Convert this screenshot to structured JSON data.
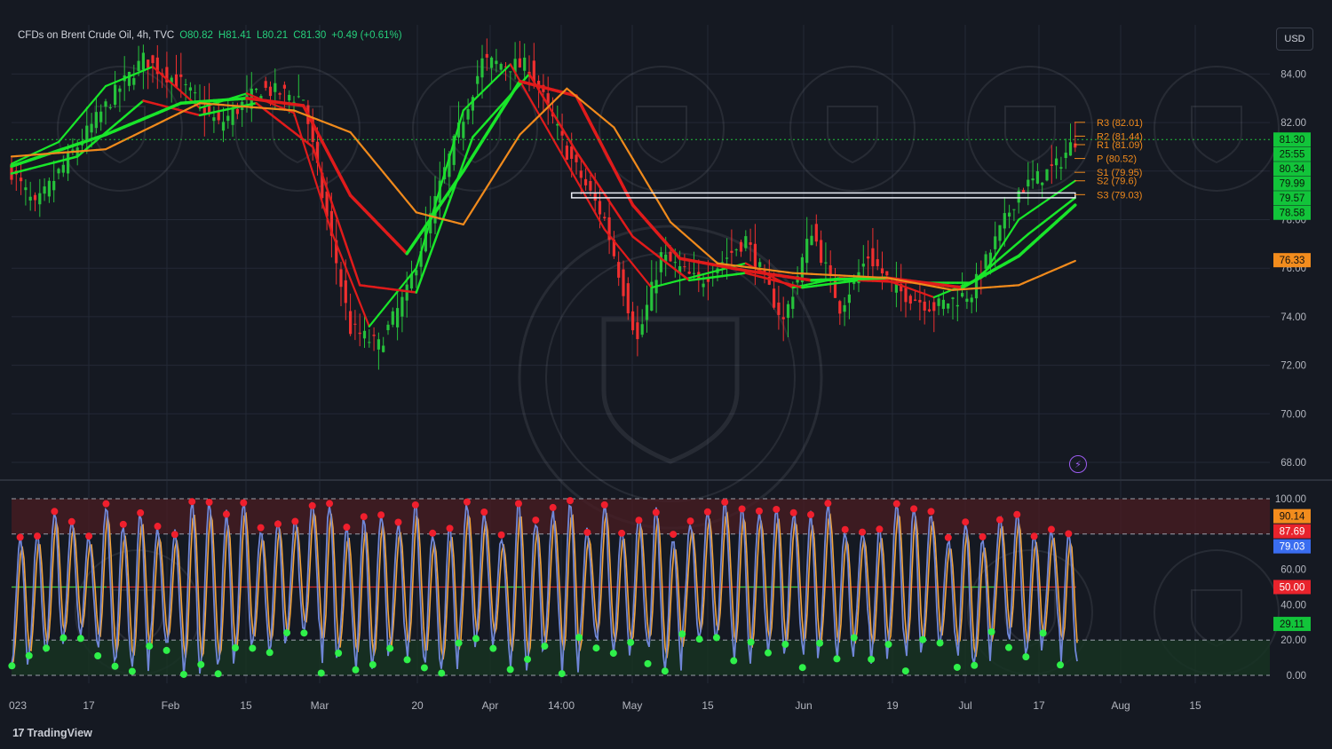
{
  "header": {
    "symbol": "CFDs on Brent Crude Oil, 4h, TVC",
    "open": "O80.82",
    "high": "H81.41",
    "low": "L80.21",
    "close": "C81.30",
    "change": "+0.49 (+0.61%)",
    "currency_label": "USD"
  },
  "brand": {
    "name": "TradingView",
    "logo_text": "17"
  },
  "colors": {
    "background": "#151922",
    "bull": "#26c13b",
    "bear": "#ef2f2f",
    "ma_green": "#19e62a",
    "ma_red": "#e01b1b",
    "ma_orange": "#f08a1c",
    "stoch_k": "#6f86d6",
    "stoch_d": "#f2a33a"
  },
  "chart_data": [
    {
      "type": "candlestick",
      "title": "",
      "ylim": [
        67,
        86
      ],
      "y_ticks": [
        68.0,
        70.0,
        72.0,
        74.0,
        76.0,
        78.0,
        80.0,
        82.0,
        84.0
      ],
      "x_ticks": [
        "023",
        "17",
        "Feb",
        "15",
        "Mar",
        "20",
        "Apr",
        "14:00",
        "May",
        "15",
        "Jun",
        "19",
        "Jul",
        "17",
        "Aug",
        "15"
      ],
      "path": [
        [
          0,
          80.0
        ],
        [
          5,
          78.5
        ],
        [
          12,
          80.5
        ],
        [
          22,
          83.2
        ],
        [
          28,
          84.6
        ],
        [
          36,
          83.6
        ],
        [
          44,
          81.9
        ],
        [
          53,
          83.4
        ],
        [
          62,
          83.0
        ],
        [
          66,
          79.0
        ],
        [
          72,
          73.5
        ],
        [
          78,
          72.8
        ],
        [
          84,
          75.0
        ],
        [
          92,
          80.0
        ],
        [
          100,
          84.5
        ],
        [
          110,
          84.3
        ],
        [
          118,
          80.8
        ],
        [
          126,
          78.0
        ],
        [
          133,
          73.0
        ],
        [
          138,
          76.5
        ],
        [
          146,
          75.4
        ],
        [
          156,
          77.2
        ],
        [
          164,
          73.8
        ],
        [
          170,
          77.6
        ],
        [
          176,
          74.4
        ],
        [
          182,
          76.5
        ],
        [
          188,
          75.1
        ],
        [
          196,
          74.4
        ],
        [
          204,
          75.0
        ],
        [
          214,
          79.2
        ],
        [
          222,
          80.2
        ],
        [
          226,
          81.3
        ]
      ],
      "moving_averages": [
        {
          "role": "fast",
          "path": [
            [
              0,
              80.3
            ],
            [
              10,
              81.2
            ],
            [
              20,
              83.5
            ],
            [
              30,
              84.3
            ],
            [
              40,
              82.6
            ],
            [
              50,
              83.2
            ],
            [
              60,
              82.4
            ],
            [
              68,
              77.5
            ],
            [
              76,
              73.6
            ],
            [
              86,
              76.0
            ],
            [
              96,
              82.5
            ],
            [
              106,
              84.4
            ],
            [
              116,
              81.0
            ],
            [
              126,
              77.6
            ],
            [
              136,
              75.2
            ],
            [
              146,
              75.7
            ],
            [
              156,
              76.2
            ],
            [
              166,
              75.2
            ],
            [
              176,
              75.6
            ],
            [
              186,
              75.5
            ],
            [
              196,
              74.8
            ],
            [
              206,
              75.6
            ],
            [
              214,
              78.0
            ],
            [
              226,
              79.6
            ]
          ]
        },
        {
          "role": "medium",
          "path": [
            [
              0,
              79.9
            ],
            [
              14,
              80.6
            ],
            [
              28,
              82.9
            ],
            [
              40,
              82.3
            ],
            [
              52,
              82.8
            ],
            [
              64,
              81.0
            ],
            [
              74,
              75.3
            ],
            [
              86,
              75.0
            ],
            [
              98,
              81.4
            ],
            [
              110,
              84.0
            ],
            [
              120,
              80.8
            ],
            [
              132,
              77.3
            ],
            [
              144,
              75.5
            ],
            [
              156,
              75.8
            ],
            [
              168,
              75.2
            ],
            [
              180,
              75.5
            ],
            [
              192,
              75.4
            ],
            [
              204,
              75.4
            ],
            [
              216,
              77.4
            ],
            [
              226,
              78.9
            ]
          ]
        },
        {
          "role": "slow",
          "path": [
            [
              0,
              80.2
            ],
            [
              20,
              81.5
            ],
            [
              36,
              82.8
            ],
            [
              50,
              83.0
            ],
            [
              62,
              82.7
            ],
            [
              72,
              79.0
            ],
            [
              84,
              76.6
            ],
            [
              96,
              80.0
            ],
            [
              108,
              83.7
            ],
            [
              120,
              83.1
            ],
            [
              132,
              78.6
            ],
            [
              142,
              76.4
            ],
            [
              156,
              75.9
            ],
            [
              170,
              75.5
            ],
            [
              186,
              75.6
            ],
            [
              202,
              75.2
            ],
            [
              214,
              76.5
            ],
            [
              226,
              78.6
            ]
          ]
        },
        {
          "role": "long",
          "path": [
            [
              0,
              80.6
            ],
            [
              20,
              80.9
            ],
            [
              40,
              82.8
            ],
            [
              60,
              82.5
            ],
            [
              72,
              81.6
            ],
            [
              86,
              78.3
            ],
            [
              96,
              77.8
            ],
            [
              108,
              81.5
            ],
            [
              118,
              83.4
            ],
            [
              128,
              81.8
            ],
            [
              140,
              77.9
            ],
            [
              150,
              76.2
            ],
            [
              166,
              75.8
            ],
            [
              186,
              75.6
            ],
            [
              200,
              75.1
            ],
            [
              214,
              75.3
            ],
            [
              226,
              76.3
            ]
          ]
        }
      ],
      "pivots": [
        {
          "label": "R3 (82.01)",
          "value": 82.01
        },
        {
          "label": "R2 (81.44)",
          "value": 81.44
        },
        {
          "label": "R1 (81.09)",
          "value": 81.09
        },
        {
          "label": "P (80.52)",
          "value": 80.52
        },
        {
          "label": "S1 (79.95)",
          "value": 79.95
        },
        {
          "label": "S2 (79.6)",
          "value": 79.6
        },
        {
          "label": "S3 (79.03)",
          "value": 79.03
        }
      ],
      "support_box": {
        "x_range": [
          119,
          226
        ],
        "y_range": [
          78.9,
          79.1
        ]
      },
      "dotted_price_line": 81.3,
      "price_labels": [
        {
          "value": 81.3,
          "text": "81.30",
          "color": "#12c43a"
        },
        {
          "value": 80.9,
          "text": "25:55",
          "color": "#12c43a"
        },
        {
          "value": 80.34,
          "text": "80.34",
          "color": "#12c43a"
        },
        {
          "value": 79.99,
          "text": "79.99",
          "color": "#12c43a"
        },
        {
          "value": 79.57,
          "text": "79.57",
          "color": "#12c43a"
        },
        {
          "value": 78.58,
          "text": "78.58",
          "color": "#12c43a"
        },
        {
          "value": 76.33,
          "text": "76.33",
          "color": "#f28c1d"
        }
      ]
    },
    {
      "type": "line",
      "title": "",
      "ylim": [
        0,
        100
      ],
      "y_ticks": [
        0.0,
        20.0,
        40.0,
        60.0,
        80.0,
        100.0
      ],
      "levels": [
        20,
        50,
        80
      ],
      "cycles": 62,
      "series": [
        {
          "role": "k"
        },
        {
          "role": "d"
        }
      ],
      "value_labels": [
        {
          "value": 90.14,
          "text": "90.14",
          "color": "#f28c1d"
        },
        {
          "value": 87.69,
          "text": "87.69",
          "color": "#e8232c"
        },
        {
          "value": 79.03,
          "text": "79.03",
          "color": "#3a6df0"
        },
        {
          "value": 50.0,
          "text": "50.00",
          "color": "#e8232c"
        },
        {
          "value": 29.11,
          "text": "29.11",
          "color": "#12c43a"
        }
      ]
    }
  ]
}
